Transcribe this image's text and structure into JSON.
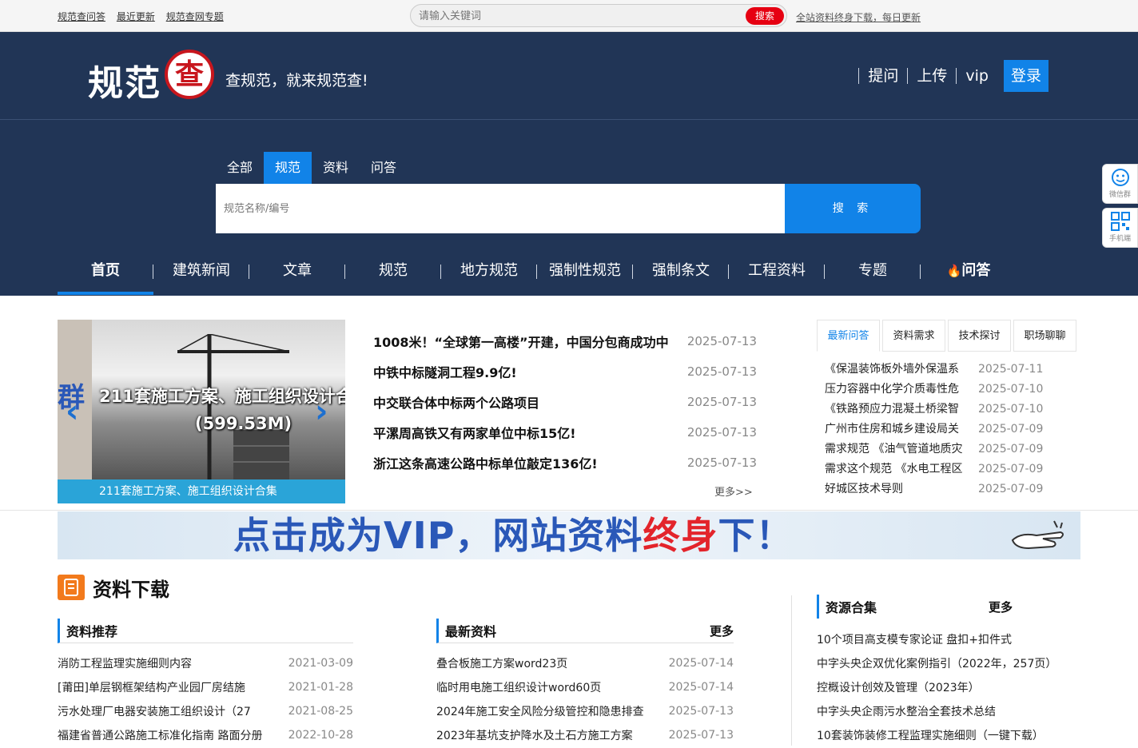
{
  "topbar": {
    "links": [
      "规范查问答",
      "最近更新",
      "规范查网专题"
    ],
    "search_placeholder": "请输入关键词",
    "search_button": "搜索",
    "promo": "全站资料终身下载，每日更新"
  },
  "header": {
    "logo_text": "规范",
    "logo_badge": "查",
    "slogan": "查规范，就来规范查!",
    "nav": [
      "提问",
      "上传",
      "vip"
    ],
    "login": "登录"
  },
  "search": {
    "tabs": [
      "全部",
      "规范",
      "资料",
      "问答"
    ],
    "active_tab": "规范",
    "placeholder": "规范名称/编号",
    "button": "搜 索"
  },
  "mainnav": {
    "items": [
      "首页",
      "建筑新闻",
      "文章",
      "规范",
      "地方规范",
      "强制性规范",
      "强制条文",
      "工程资料",
      "专题",
      "问答"
    ],
    "active": "首页"
  },
  "float": {
    "wechat": "微信群",
    "mobile": "手机端"
  },
  "slider": {
    "title": "211套施工方案、施工组织设计合",
    "size": "(599.53M)",
    "caption": "211套施工方案、施工组织设计合集",
    "left_char": "群"
  },
  "news": {
    "items": [
      {
        "title": "1008米！“全球第一高楼”开建，中国分包商成功中",
        "date": "2025-07-13"
      },
      {
        "title": "中铁中标隧洞工程9.9亿!",
        "date": "2025-07-13"
      },
      {
        "title": "中交联合体中标两个公路项目",
        "date": "2025-07-13"
      },
      {
        "title": "平漯周高铁又有两家单位中标15亿!",
        "date": "2025-07-13"
      },
      {
        "title": "浙江这条高速公路中标单位敲定136亿!",
        "date": "2025-07-13"
      }
    ],
    "more": "更多>>"
  },
  "qa": {
    "tabs": [
      "最新问答",
      "资料需求",
      "技术探讨",
      "职场聊聊"
    ],
    "active": "最新问答",
    "items": [
      {
        "q": "《保温装饰板外墙外保温系",
        "d": "2025-07-11"
      },
      {
        "q": "压力容器中化学介质毒性危",
        "d": "2025-07-10"
      },
      {
        "q": "《铁路预应力混凝土桥梁智",
        "d": "2025-07-10"
      },
      {
        "q": "广州市住房和城乡建设局关",
        "d": "2025-07-09"
      },
      {
        "q": "需求规范 《油气管道地质灾",
        "d": "2025-07-09"
      },
      {
        "q": "需求这个规范 《水电工程区",
        "d": "2025-07-09"
      },
      {
        "q": "好城区技术导则",
        "d": "2025-07-09"
      }
    ]
  },
  "vip_banner": {
    "part1": "点击成为VIP，网站资料",
    "part2": "终身",
    "part3": "下！"
  },
  "downloads": {
    "title": "资料下载",
    "recommend": {
      "header": "资料推荐",
      "items": [
        {
          "t": "消防工程监理实施细则内容",
          "d": "2021-03-09"
        },
        {
          "t": "[莆田]单层钢框架结构产业园厂房结施",
          "d": "2021-01-28"
        },
        {
          "t": "污水处理厂电器安装施工组织设计（27",
          "d": "2021-08-25"
        },
        {
          "t": "福建省普通公路施工标准化指南 路面分册",
          "d": "2022-10-28"
        }
      ]
    },
    "latest": {
      "header": "最新资料",
      "more": "更多",
      "items": [
        {
          "t": "叠合板施工方案word23页",
          "d": "2025-07-14"
        },
        {
          "t": "临时用电施工组织设计word60页",
          "d": "2025-07-14"
        },
        {
          "t": "2024年施工安全风险分级管控和隐患排查",
          "d": "2025-07-13"
        },
        {
          "t": "2023年基坑支护降水及土石方施工方案",
          "d": "2025-07-13"
        }
      ]
    },
    "resources": {
      "header": "资源合集",
      "more": "更多",
      "items": [
        "10个项目高支模专家论证 盘扣+扣件式",
        "中字头央企双优化案例指引（2022年，257页）",
        "控概设计创效及管理（2023年）",
        "中字头央企雨污水整治全套技术总结",
        "10套装饰装修工程监理实施细则（一键下载）"
      ]
    }
  },
  "colors": {
    "navy": "#213556",
    "blue": "#1183e8",
    "red": "#e60012",
    "orange": "#f27a1c"
  }
}
